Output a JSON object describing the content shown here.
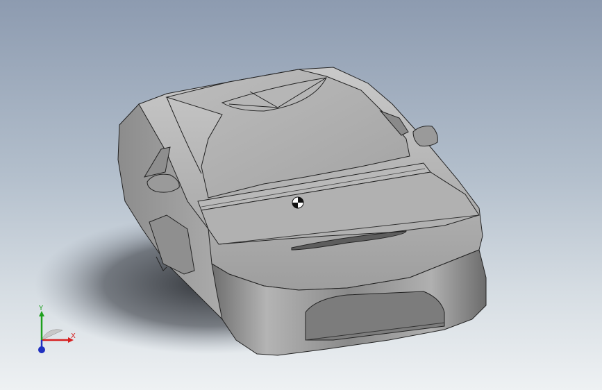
{
  "viewport": {
    "background_top": "#8d9bb0",
    "background_bottom": "#eef1f3"
  },
  "model": {
    "body_color": "#a9a9a9",
    "shadow_color": "#3a3d42"
  },
  "triad": {
    "x_label": "X",
    "y_label": "Y",
    "x_color": "#d62020",
    "y_color": "#1ea01e",
    "z_color": "#2030c0"
  }
}
